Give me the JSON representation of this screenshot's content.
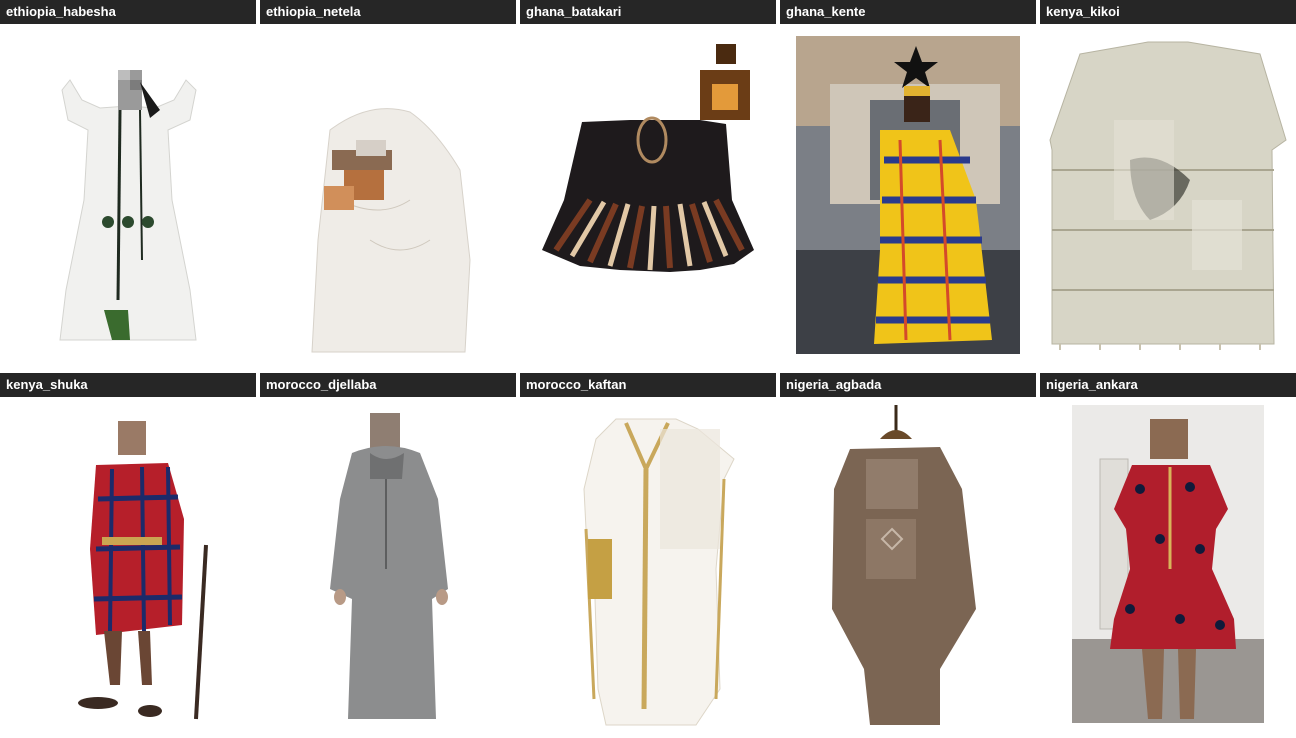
{
  "gallery": {
    "items": [
      {
        "label": "ethiopia_habesha"
      },
      {
        "label": "ethiopia_netela"
      },
      {
        "label": "ghana_batakari"
      },
      {
        "label": "ghana_kente"
      },
      {
        "label": "kenya_kikoi"
      },
      {
        "label": "kenya_shuka"
      },
      {
        "label": "morocco_djellaba"
      },
      {
        "label": "morocco_kaftan"
      },
      {
        "label": "nigeria_agbada"
      },
      {
        "label": "nigeria_ankara"
      }
    ]
  }
}
